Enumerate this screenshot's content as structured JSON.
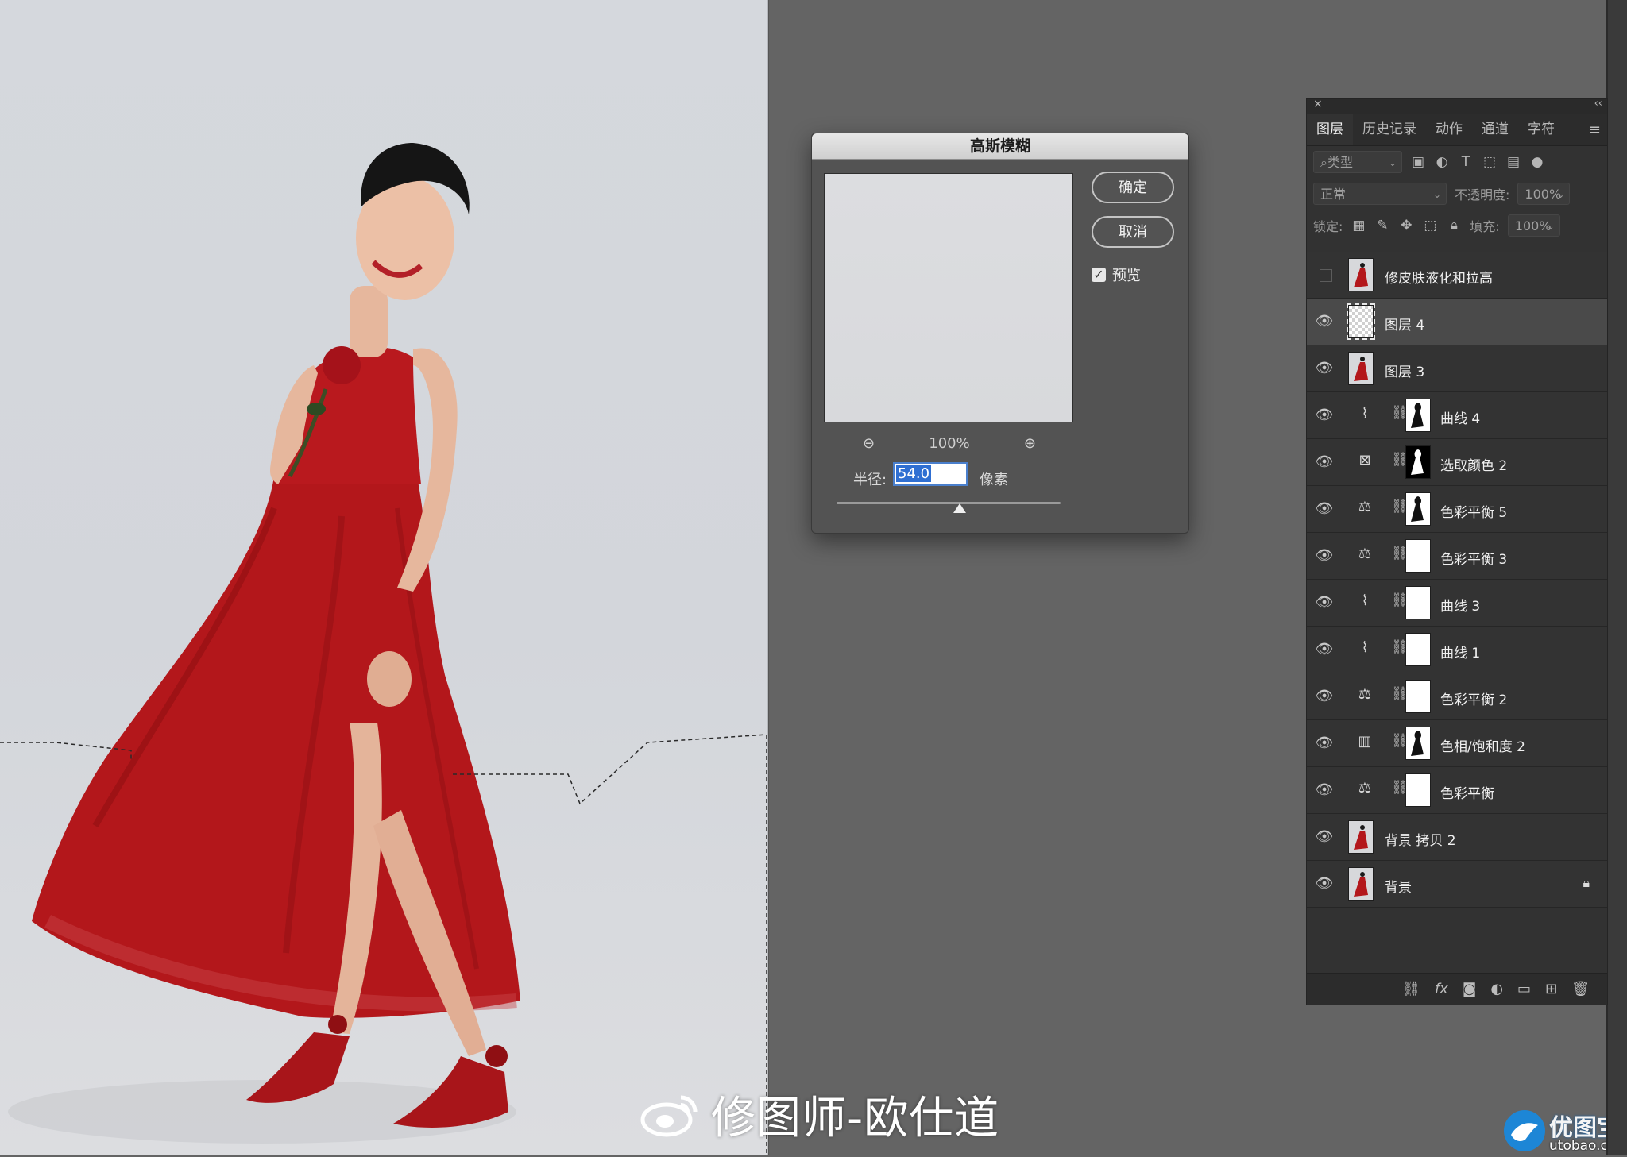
{
  "dialog": {
    "title": "高斯模糊",
    "ok_label": "确定",
    "cancel_label": "取消",
    "preview_label": "预览",
    "preview_checked": true,
    "zoom_level": "100%",
    "radius_label": "半径:",
    "radius_value": "54.0",
    "radius_unit": "像素",
    "slider_position": 0.55
  },
  "panel": {
    "tabs": [
      "图层",
      "历史记录",
      "动作",
      "通道",
      "字符"
    ],
    "filter_placeholder": "类型",
    "blend_mode": "正常",
    "opacity_label": "不透明度:",
    "opacity_value": "100%",
    "lock_label": "锁定:",
    "fill_label": "填充:",
    "fill_value": "100%",
    "layers": [
      {
        "name": "修皮肤液化和拉高",
        "visible": false,
        "type": "photo"
      },
      {
        "name": "图层 4",
        "visible": true,
        "type": "empty",
        "selected": true
      },
      {
        "name": "图层 3",
        "visible": true,
        "type": "photo"
      },
      {
        "name": "曲线 4",
        "visible": true,
        "type": "adjust",
        "icon": "curves-icon",
        "mask": "figure"
      },
      {
        "name": "选取颜色 2",
        "visible": true,
        "type": "adjust",
        "icon": "selective-color-icon",
        "mask": "figure-dark"
      },
      {
        "name": "色彩平衡 5",
        "visible": true,
        "type": "adjust",
        "icon": "color-balance-icon",
        "mask": "figure"
      },
      {
        "name": "色彩平衡 3",
        "visible": true,
        "type": "adjust",
        "icon": "color-balance-icon",
        "mask": "white"
      },
      {
        "name": "曲线 3",
        "visible": true,
        "type": "adjust",
        "icon": "curves-icon",
        "mask": "white"
      },
      {
        "name": "曲线 1",
        "visible": true,
        "type": "adjust",
        "icon": "curves-icon",
        "mask": "white"
      },
      {
        "name": "色彩平衡 2",
        "visible": true,
        "type": "adjust",
        "icon": "color-balance-icon",
        "mask": "white"
      },
      {
        "name": "色相/饱和度 2",
        "visible": true,
        "type": "adjust",
        "icon": "hue-saturation-icon",
        "mask": "figure"
      },
      {
        "name": "色彩平衡",
        "visible": true,
        "type": "adjust",
        "icon": "color-balance-icon",
        "mask": "white"
      },
      {
        "name": "背景 拷贝 2",
        "visible": true,
        "type": "photo"
      },
      {
        "name": "背景",
        "visible": true,
        "type": "photo",
        "locked": true
      }
    ]
  },
  "watermark": {
    "text": "修图师-欧仕道"
  },
  "corner_logo": {
    "brand": "优图宝",
    "site": "utobao.com"
  },
  "colors": {
    "dress": "#b3171b",
    "background": "#d5d8dd",
    "workspace": "#646464",
    "panel": "#323232",
    "accent": "#2f6fd2"
  }
}
